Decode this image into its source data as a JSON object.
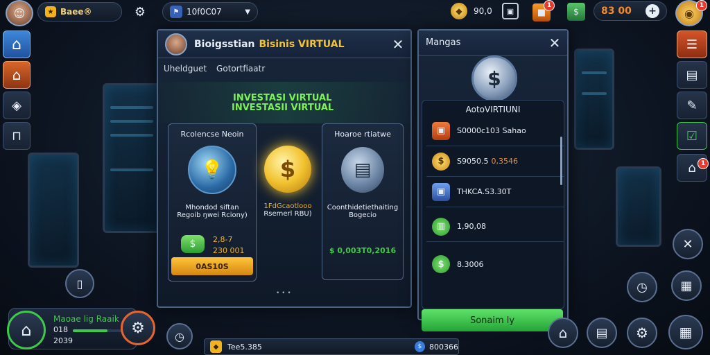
{
  "top_bar": {
    "player_name": "Baee®",
    "search_value": "10f0C07",
    "coins_value": "90,0",
    "cash_value": "83 00"
  },
  "main_panel": {
    "title_part1": "Bioigsstian",
    "title_part2": "Bisinis VIRTUAL",
    "tab1": "Uheldguet",
    "tab2": "Gotortfiaatr",
    "banner_line1": "INVESTASI VIRTUAL",
    "banner_line2": "INVESTASII VIRTUAL",
    "card1": {
      "title": "Rcolencse Neoin",
      "desc_line1": "Mhondod siftan",
      "desc_line2": "Regoib ŋwei Rciony)",
      "stat1": "2,8-7",
      "stat2": "230 001",
      "button": "0AS10S"
    },
    "card2": {
      "desc_line1": "1FdGcaotlooo",
      "desc_line2": "Rsemerl RBU)"
    },
    "card3": {
      "title": "Hoaroe rtiatwe",
      "desc_line1": "Coonthidetiethaiting",
      "desc_line2": "Bogecio",
      "value": "$ 0,003T0,2016"
    },
    "pager": "• • •"
  },
  "side_panel": {
    "title": "Mangas",
    "subtitle": "AotoVIRTIUNI",
    "rows": [
      {
        "label": "S0000c103 Sahao",
        "label_b": ""
      },
      {
        "label": "S9050.5",
        "label_b": "0,3546"
      },
      {
        "label": "THKCA.S3.30T",
        "label_b": ""
      },
      {
        "label": "1,90,08",
        "label_b": ""
      },
      {
        "label": "8.3006",
        "label_b": ""
      }
    ],
    "button": "Sonaim ly"
  },
  "bottom_left": {
    "title": "Maoae lig Raaik",
    "line1": "018",
    "line2": "2039"
  },
  "bottom_bar": {
    "value1": "Tee5.385",
    "value2": "800366"
  },
  "colors": {
    "accent_gold": "#f2b21c",
    "accent_green": "#3ec94a",
    "panel_border": "#4a6488",
    "danger": "#e53b2e"
  }
}
